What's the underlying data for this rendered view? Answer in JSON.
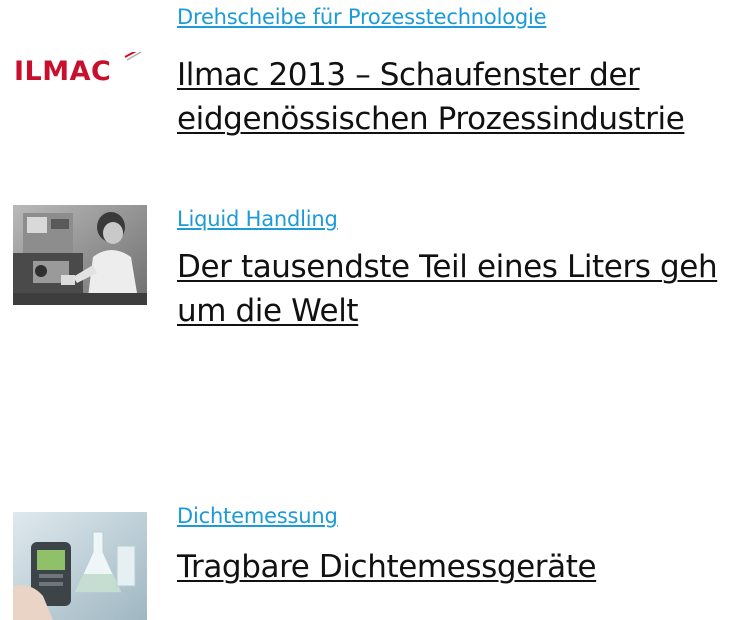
{
  "articles": [
    {
      "kicker": "Drehscheibe für Prozesstechnologie",
      "headline": "Ilmac 2013 – Schaufenster der eidgenössischen Prozessindustrie",
      "thumb": {
        "kind": "logo",
        "logo_text": "ILMAC",
        "colors": {
          "text": "#c8102e",
          "accent": "#b0b0b0"
        }
      }
    },
    {
      "kicker": "Liquid Handling",
      "headline_line1": "Der tausendste Teil eines Liters geh",
      "headline_line2": "um die Welt",
      "thumb": {
        "kind": "photo",
        "subject": "laboratory-worker-photo",
        "tone": "grayscale"
      }
    },
    {
      "kicker": "Dichtemessung",
      "headline": "Tragbare Dichtemessgeräte",
      "thumb": {
        "kind": "photo",
        "subject": "density-meter-photo",
        "tone": "pale-blue"
      }
    }
  ]
}
